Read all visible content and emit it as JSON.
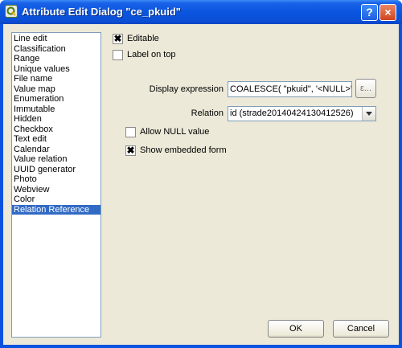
{
  "window": {
    "title": "Attribute Edit Dialog \"ce_pkuid\""
  },
  "titlebar_buttons": {
    "help": "?",
    "close": "×"
  },
  "widget_types": [
    "Line edit",
    "Classification",
    "Range",
    "Unique values",
    "File name",
    "Value map",
    "Enumeration",
    "Immutable",
    "Hidden",
    "Checkbox",
    "Text edit",
    "Calendar",
    "Value relation",
    "UUID generator",
    "Photo",
    "Webview",
    "Color",
    "Relation Reference"
  ],
  "selected_widget": "Relation Reference",
  "options": {
    "editable": {
      "label": "Editable",
      "checked": true
    },
    "label_on_top": {
      "label": "Label on top",
      "checked": false
    }
  },
  "form": {
    "display_expression_label": "Display expression",
    "display_expression_value": "COALESCE( \"pkuid\", '<NULL>' )",
    "expression_button": "ε...",
    "relation_label": "Relation",
    "relation_value": "id (strade20140424130412526)",
    "allow_null": {
      "label": "Allow NULL value",
      "checked": false
    },
    "show_embedded": {
      "label": "Show embedded form",
      "checked": true
    }
  },
  "buttons": {
    "ok": "OK",
    "cancel": "Cancel"
  }
}
